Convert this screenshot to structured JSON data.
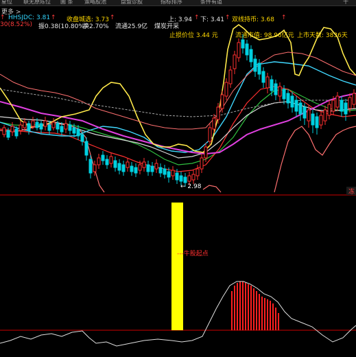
{
  "tabs": [
    {
      "label": "星位"
    },
    {
      "label": "联无原陈位"
    },
    {
      "label": "圃 条"
    },
    {
      "label": "策略股池"
    },
    {
      "label": "盘盟诊股"
    },
    {
      "label": "指标排序"
    },
    {
      "label": "条件有道"
    },
    {
      "label": "十"
    }
  ],
  "subheader": {
    "left": "更多 >"
  },
  "indicator_line1": {
    "hhsjdc_label": "HHSJDC: 3.81",
    "shoupan_label": "收盘城选: 3.73",
    "up_label": "上: 3.94",
    "down_label": "下: 3.41",
    "double_label": "双线持币: 3.68",
    "up_arrow": "↑",
    "down_arrow": "↓"
  },
  "indicator_line2": {
    "pct": "30(8.52%)",
    "swing": "振0.38(10.80%)",
    "change": "换2.70%",
    "float": "流通25.9亿",
    "industry": "煤炭开采"
  },
  "info_line": {
    "stop_loss": "止损价位 3.44 元",
    "float_mv": "流通市值: 98.96亿元",
    "days": "上市天数: 3836天"
  },
  "price_low_label": "← 2.98",
  "badge_right": "冻",
  "lower_panel": {
    "signal_label": "---牛股起点"
  },
  "colors": {
    "up": "#ff3030",
    "down": "#00d0e0",
    "yellow_line": "#ffe94a",
    "magenta_line": "#e040e0",
    "cyan_line": "#40d8ff",
    "red_line": "#ff3030",
    "green_line": "#30c040",
    "white_line": "#e0e0e0",
    "pink_line": "#ff8080"
  }
}
